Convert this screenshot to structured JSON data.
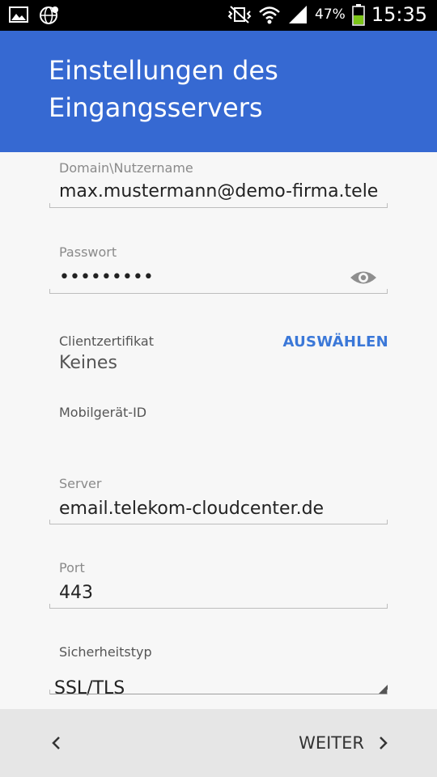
{
  "status_bar": {
    "battery_percent": "47%",
    "time": "15:35",
    "icons": [
      "gallery-icon",
      "globe-icon",
      "vibrate-mute-icon",
      "wifi-icon",
      "signal-icon",
      "battery-icon"
    ]
  },
  "header": {
    "title": "Einstellungen des Eingangsservers",
    "background": "#3669d2"
  },
  "form": {
    "username": {
      "label": "Domain\\Nutzername",
      "value": "max.mustermann@demo-firma.telek"
    },
    "password": {
      "label": "Passwort",
      "value": "•••••••••",
      "eye_icon": "eye-icon"
    },
    "client_cert": {
      "label": "Clientzertifikat",
      "value": "Keines",
      "button": "AUSWÄHLEN"
    },
    "device_id": {
      "label": "Mobilgerät-ID"
    },
    "server": {
      "label": "Server",
      "value": "email.telekom-cloudcenter.de"
    },
    "port": {
      "label": "Port",
      "value": "443"
    },
    "security_type": {
      "label": "Sicherheitstyp",
      "value": "SSL/TLS"
    }
  },
  "bottom_bar": {
    "back_icon": "chevron-left-icon",
    "next_label": "WEITER",
    "next_icon": "chevron-right-icon"
  }
}
